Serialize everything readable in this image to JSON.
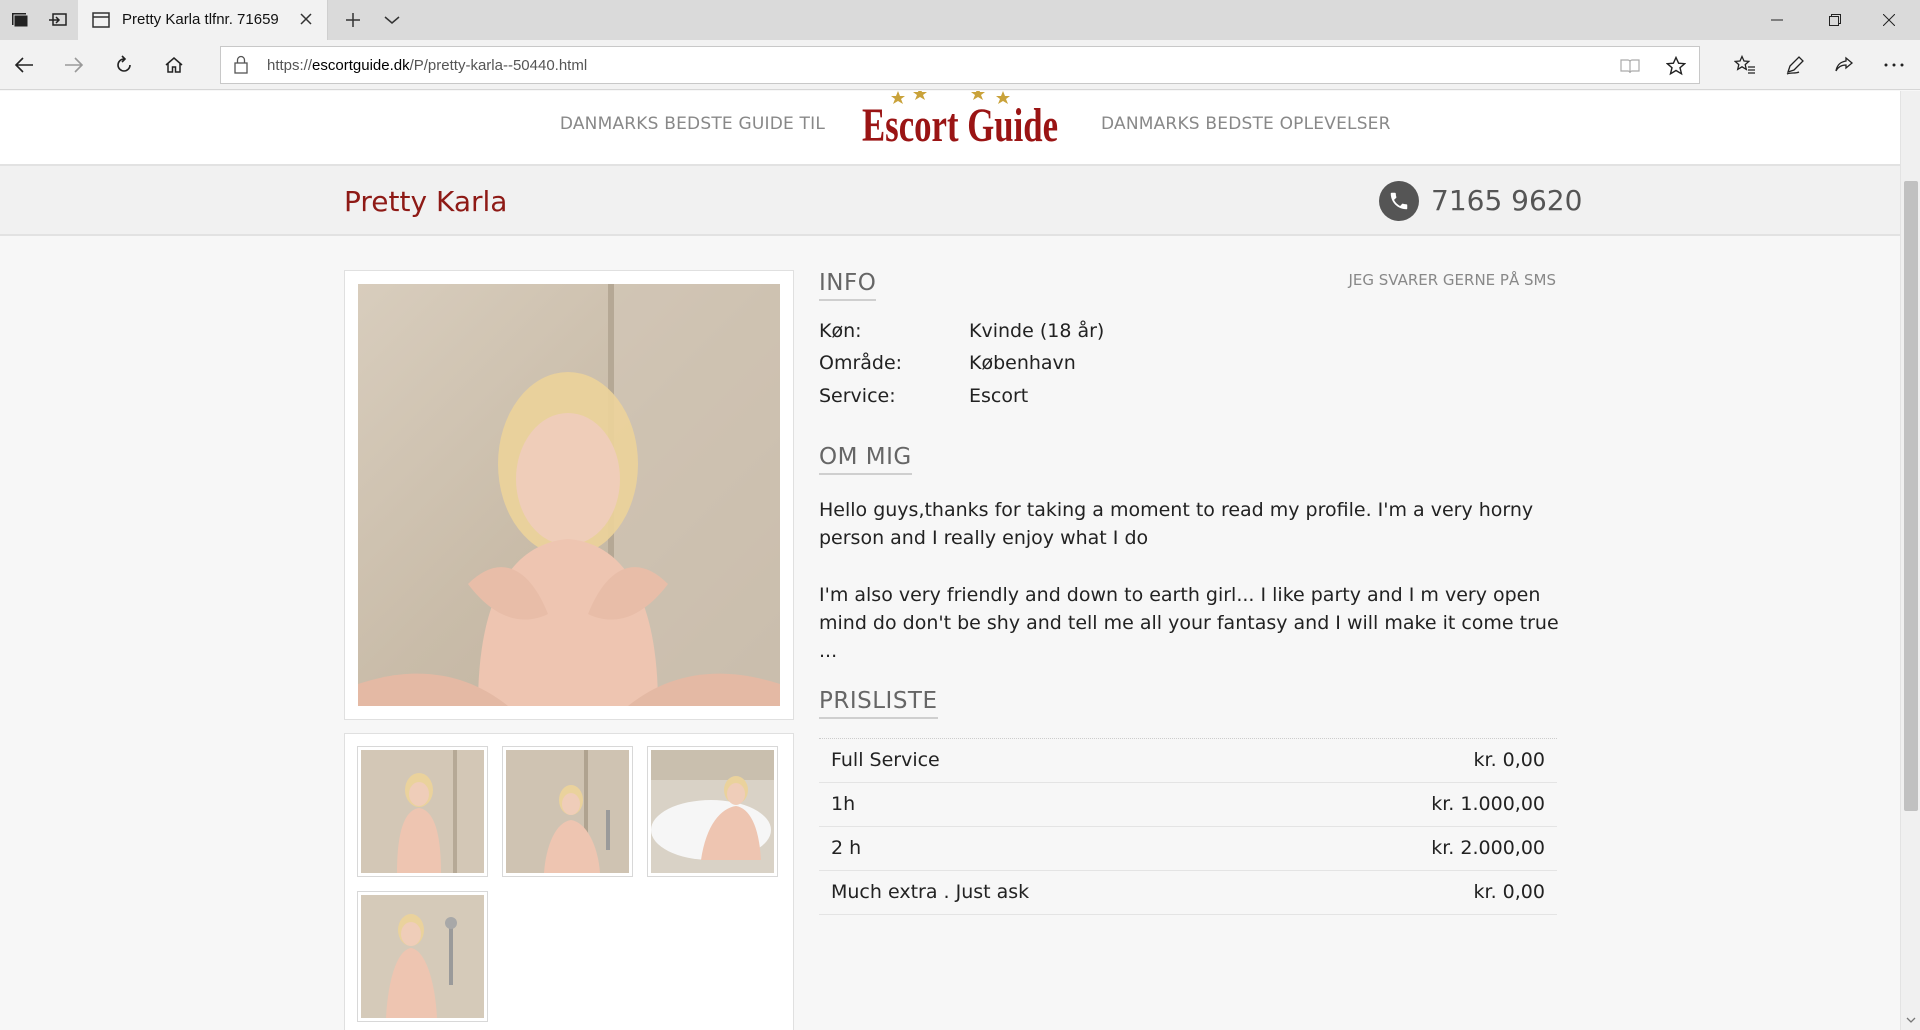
{
  "browser": {
    "tab_title": "Pretty Karla tlfnr. 71659",
    "url_prefix": "https://",
    "url_host": "escortguide.dk",
    "url_path": "/P/pretty-karla--50440.html"
  },
  "header": {
    "left_text": "DANMARKS BEDSTE GUIDE TIL",
    "logo_text": "Escort Guide",
    "right_text": "DANMARKS BEDSTE OPLEVELSER"
  },
  "profile": {
    "name": "Pretty Karla",
    "phone": "7165 9620",
    "sms_note": "JEG SVARER GERNE PÅ SMS"
  },
  "info": {
    "title": "INFO",
    "rows": [
      {
        "label": "Køn:",
        "value": "Kvinde (18 år)"
      },
      {
        "label": "Område:",
        "value": "København"
      },
      {
        "label": "Service:",
        "value": "Escort"
      }
    ]
  },
  "about": {
    "title": "OM MIG",
    "paragraphs": [
      "Hello guys,thanks for taking a moment to read my profile. I'm a very horny person and I really enjoy what I do",
      "I'm also very friendly and down to earth girl... I like party and I m very open mind do don't be shy and tell me all your fantasy and I will make it come true ..."
    ]
  },
  "prices": {
    "title": "PRISLISTE",
    "rows": [
      {
        "label": "Full Service",
        "value": "kr. 0,00"
      },
      {
        "label": "1h",
        "value": "kr. 1.000,00"
      },
      {
        "label": "2 h",
        "value": "kr. 2.000,00"
      },
      {
        "label": "Much extra . Just ask",
        "value": "kr. 0,00"
      }
    ]
  },
  "colors": {
    "accent": "#8e1a16",
    "muted_text": "#888888"
  }
}
